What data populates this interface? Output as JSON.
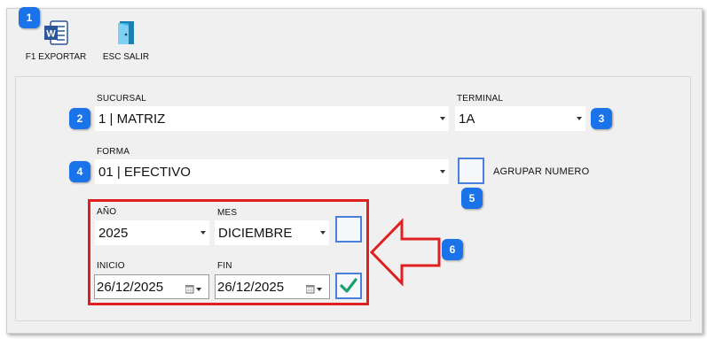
{
  "toolbar": {
    "export_label": "F1 EXPORTAR",
    "exit_label": "ESC SALIR"
  },
  "form": {
    "sucursal": {
      "label": "SUCURSAL",
      "value": "1 | MATRIZ"
    },
    "terminal": {
      "label": "TERMINAL",
      "value": "1A"
    },
    "forma": {
      "label": "FORMA",
      "value": "01 | EFECTIVO"
    },
    "agrupar_label": "AGRUPAR NUMERO",
    "anio": {
      "label": "AÑO",
      "value": "2025"
    },
    "mes": {
      "label": "MES",
      "value": "DICIEMBRE"
    },
    "inicio": {
      "label": "INICIO",
      "value": "26/12/2025"
    },
    "fin": {
      "label": "FIN",
      "value": "26/12/2025"
    }
  },
  "badges": [
    "1",
    "2",
    "3",
    "4",
    "5",
    "6"
  ],
  "colors": {
    "badge": "#1a73e8",
    "highlight": "#e02020",
    "check_border": "#4a7fdb",
    "check_mark": "#1aa06b"
  }
}
